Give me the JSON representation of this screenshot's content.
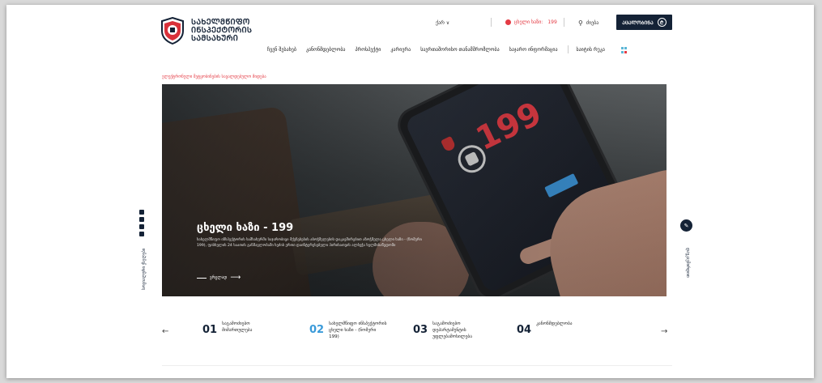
{
  "header": {
    "logo_lines": [
      "ᲡᲐᲮᲔᲚᲛᲬᲘᲤᲝ",
      "ᲘᲜᲡᲞᲔᲥᲢᲝᲠᲘᲡ",
      "ᲡᲐᲛᲡᲐᲮᲣᲠᲘ"
    ],
    "lang": "ქარ ∨",
    "hotline_label": "ცხელი ხაზი:",
    "hotline_number": "199",
    "search_label": "ძიება",
    "report_label": "ᲐᲪᲐᲚᲝᲑᲘᲜᲐ",
    "report_icon": "₾"
  },
  "nav": {
    "items": [
      "ჩვენ შესახებ",
      "კანონმდებლობა",
      "პროსპექტი",
      "კარიერა",
      "საერთაშორისო თანამშრომლობა",
      "საჯარო ინფორმაცია"
    ],
    "sitemap_label": "საიტის რუკა"
  },
  "breadcrumb": "ელექტრონული შეტყობინების სავალდებულო მიდება",
  "hero": {
    "title": "ცხელი ხაზი - 199",
    "description": "სახელმწიფო ინსპექტორის სამსახურში საჯარობივი მქენებების აბოჭმელების დაკავშირებით აზოჭმელა ცხელი ხაზი - (ნომერი 199), ფისხულის 24 საათის განმავლობაში ხეძის ერთი დაინტერესებული პირისათვის ალბეჭა ხელმისაწვდომი",
    "more_label": "ვრცლად"
  },
  "social": {
    "icons": [
      "youtube-icon",
      "facebook-icon",
      "instagram-icon",
      "twitter-icon"
    ]
  },
  "side": {
    "left_text": "სოციალური ქსელები",
    "right_text": "დაუკავშირდით"
  },
  "steps": [
    {
      "num": "01",
      "label": "საგამოძიებო მიმართულება"
    },
    {
      "num": "02",
      "label": "სახელმწიფო ინსპექტორის ცხელი ხაზი - (ნომერი 199)"
    },
    {
      "num": "03",
      "label": "საგამოძიებო დეპარტამენტის უფლებამოსილება"
    },
    {
      "num": "04",
      "label": "კანონმდებლობა"
    }
  ],
  "colors": {
    "brand": "#142236",
    "accent_red": "#e43b44",
    "accent_blue": "#3a9ad9"
  }
}
